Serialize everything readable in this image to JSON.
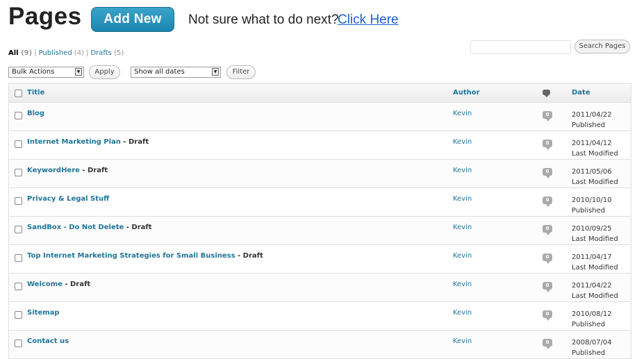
{
  "header": {
    "title": "Pages",
    "add_new_label": "Add New",
    "help_text": "Not sure what to do next?",
    "help_link": "Click Here"
  },
  "filters": {
    "all": {
      "label": "All",
      "count": "(9)"
    },
    "published": {
      "label": "Published",
      "count": "(4)"
    },
    "drafts": {
      "label": "Drafts",
      "count": "(5)"
    },
    "separator": "|"
  },
  "search": {
    "button_label": "Search Pages"
  },
  "toolbar": {
    "bulk_actions": "Bulk Actions",
    "apply_label": "Apply",
    "dates": "Show all dates",
    "filter_label": "Filter"
  },
  "table": {
    "columns": {
      "title": "Title",
      "author": "Author",
      "date": "Date"
    },
    "rows": [
      {
        "title": "Blog",
        "state": "",
        "author": "Kevin",
        "comments": "0",
        "date": "2011/04/22",
        "status": "Published"
      },
      {
        "title": "Internet Marketing Plan",
        "state": " - Draft",
        "author": "Kevin",
        "comments": "0",
        "date": "2011/04/12",
        "status": "Last Modified"
      },
      {
        "title": "KeywordHere",
        "state": " - Draft",
        "author": "Kevin",
        "comments": "0",
        "date": "2011/05/06",
        "status": "Last Modified"
      },
      {
        "title": "Privacy & Legal Stuff",
        "state": "",
        "author": "Kevin",
        "comments": "0",
        "date": "2010/10/10",
        "status": "Published"
      },
      {
        "title": "SandBox - Do Not Delete",
        "state": " - Draft",
        "author": "Kevin",
        "comments": "0",
        "date": "2010/09/25",
        "status": "Last Modified"
      },
      {
        "title": "Top Internet Marketing Strategies for Small Business",
        "state": " - Draft",
        "author": "Kevin",
        "comments": "0",
        "date": "2011/04/17",
        "status": "Last Modified"
      },
      {
        "title": "Welcome",
        "state": " - Draft",
        "author": "Kevin",
        "comments": "0",
        "date": "2011/04/22",
        "status": "Last Modified"
      },
      {
        "title": "Sitemap",
        "state": "",
        "author": "Kevin",
        "comments": "0",
        "date": "2010/08/12",
        "status": "Published"
      },
      {
        "title": "Contact us",
        "state": "",
        "author": "Kevin",
        "comments": "0",
        "date": "2008/07/04",
        "status": "Published"
      }
    ]
  },
  "colors": {
    "link": "#21759b",
    "button": "#1b86b0"
  }
}
